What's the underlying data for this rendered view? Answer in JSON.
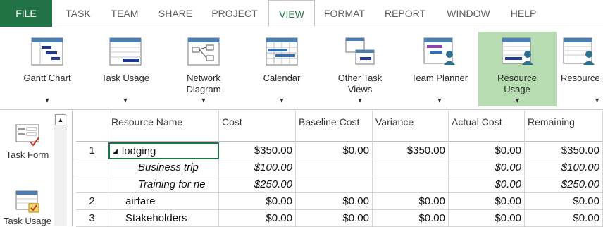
{
  "tabs": [
    {
      "label": "FILE"
    },
    {
      "label": "TASK"
    },
    {
      "label": "TEAM"
    },
    {
      "label": "SHARE"
    },
    {
      "label": "PROJECT"
    },
    {
      "label": "VIEW"
    },
    {
      "label": "FORMAT"
    },
    {
      "label": "REPORT"
    },
    {
      "label": "WINDOW"
    },
    {
      "label": "HELP"
    }
  ],
  "ribbon": {
    "buttons": [
      {
        "label": "Gantt Chart",
        "icon": "gantt-chart-icon"
      },
      {
        "label": "Task Usage",
        "icon": "task-usage-icon"
      },
      {
        "label": "Network Diagram",
        "icon": "network-diagram-icon"
      },
      {
        "label": "Calendar",
        "icon": "calendar-icon"
      },
      {
        "label": "Other Task Views",
        "icon": "other-task-views-icon"
      },
      {
        "label": "Team Planner",
        "icon": "team-planner-icon"
      },
      {
        "label": "Resource Usage",
        "icon": "resource-usage-icon"
      },
      {
        "label": "Resource",
        "icon": "resource-sheet-icon"
      }
    ],
    "dropdown_glyph": "▼"
  },
  "leftpane": {
    "items": [
      {
        "label": "Task Form"
      },
      {
        "label": "Task Usage"
      }
    ],
    "scroll_glyph": "▲"
  },
  "grid": {
    "columns": [
      "",
      "Resource Name",
      "Cost",
      "Baseline Cost",
      "Variance",
      "Actual Cost",
      "Remaining"
    ],
    "rows": [
      {
        "id": "1",
        "name": "lodging",
        "expand": "◢",
        "cost": "$350.00",
        "baseline": "$0.00",
        "variance": "$350.00",
        "actual": "$0.00",
        "remaining": "$350.00",
        "italic": false,
        "indent": 1
      },
      {
        "id": "",
        "name": "Business trip",
        "expand": "",
        "cost": "$100.00",
        "baseline": "",
        "variance": "",
        "actual": "$0.00",
        "remaining": "$100.00",
        "italic": true,
        "indent": 2
      },
      {
        "id": "",
        "name": "Training for ne",
        "expand": "",
        "cost": "$250.00",
        "baseline": "",
        "variance": "",
        "actual": "$0.00",
        "remaining": "$250.00",
        "italic": true,
        "indent": 2
      },
      {
        "id": "2",
        "name": "airfare",
        "expand": "",
        "cost": "$0.00",
        "baseline": "$0.00",
        "variance": "$0.00",
        "actual": "$0.00",
        "remaining": "$0.00",
        "italic": false,
        "indent": 1
      },
      {
        "id": "3",
        "name": "Stakeholders",
        "expand": "",
        "cost": "$0.00",
        "baseline": "$0.00",
        "variance": "$0.00",
        "actual": "$0.00",
        "remaining": "$0.00",
        "italic": false,
        "indent": 1
      }
    ]
  },
  "colors": {
    "accent": "#217346",
    "selected": "#b7dcb2"
  }
}
